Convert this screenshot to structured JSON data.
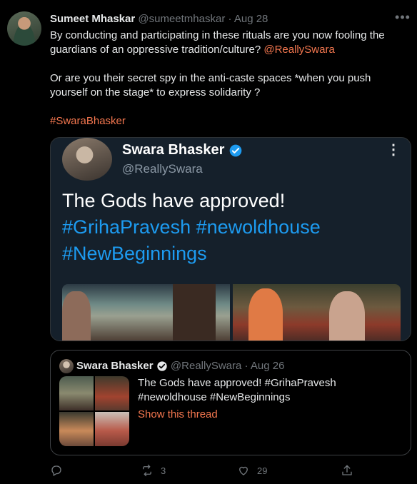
{
  "tweet": {
    "author_name": "Sumeet Mhaskar",
    "author_handle": "@sumeetmhaskar",
    "separator": "·",
    "date": "Aug 28",
    "paragraphs": [
      {
        "text": "By conducting and participating in these rituals are you now fooling the guardians of an oppressive tradition/culture? ",
        "mention": "@ReallySwara"
      },
      {
        "text": "Or are you their secret spy in the anti-caste  spaces *when you push yourself on the stage* to express solidarity ?"
      }
    ],
    "hashtag": "#SwaraBhasker"
  },
  "screenshot": {
    "name": "Swara Bhasker",
    "handle": "@ReallySwara",
    "line1": "The Gods have approved!",
    "line2": "#GrihaPravesh #newoldhouse",
    "line3": "#NewBeginnings"
  },
  "quote": {
    "name": "Swara Bhasker",
    "handle": "@ReallySwara",
    "separator": "·",
    "date": "Aug 26",
    "text": "The Gods have approved! #GrihaPravesh #newoldhouse #NewBeginnings",
    "thread_link": "Show this thread"
  },
  "actions": {
    "reply_count": "",
    "retweet_count": "3",
    "like_count": "29"
  },
  "colors": {
    "accent": "#f4774f",
    "screenshot_link": "#1d9bf0",
    "muted": "#71767b",
    "background": "#000000"
  }
}
